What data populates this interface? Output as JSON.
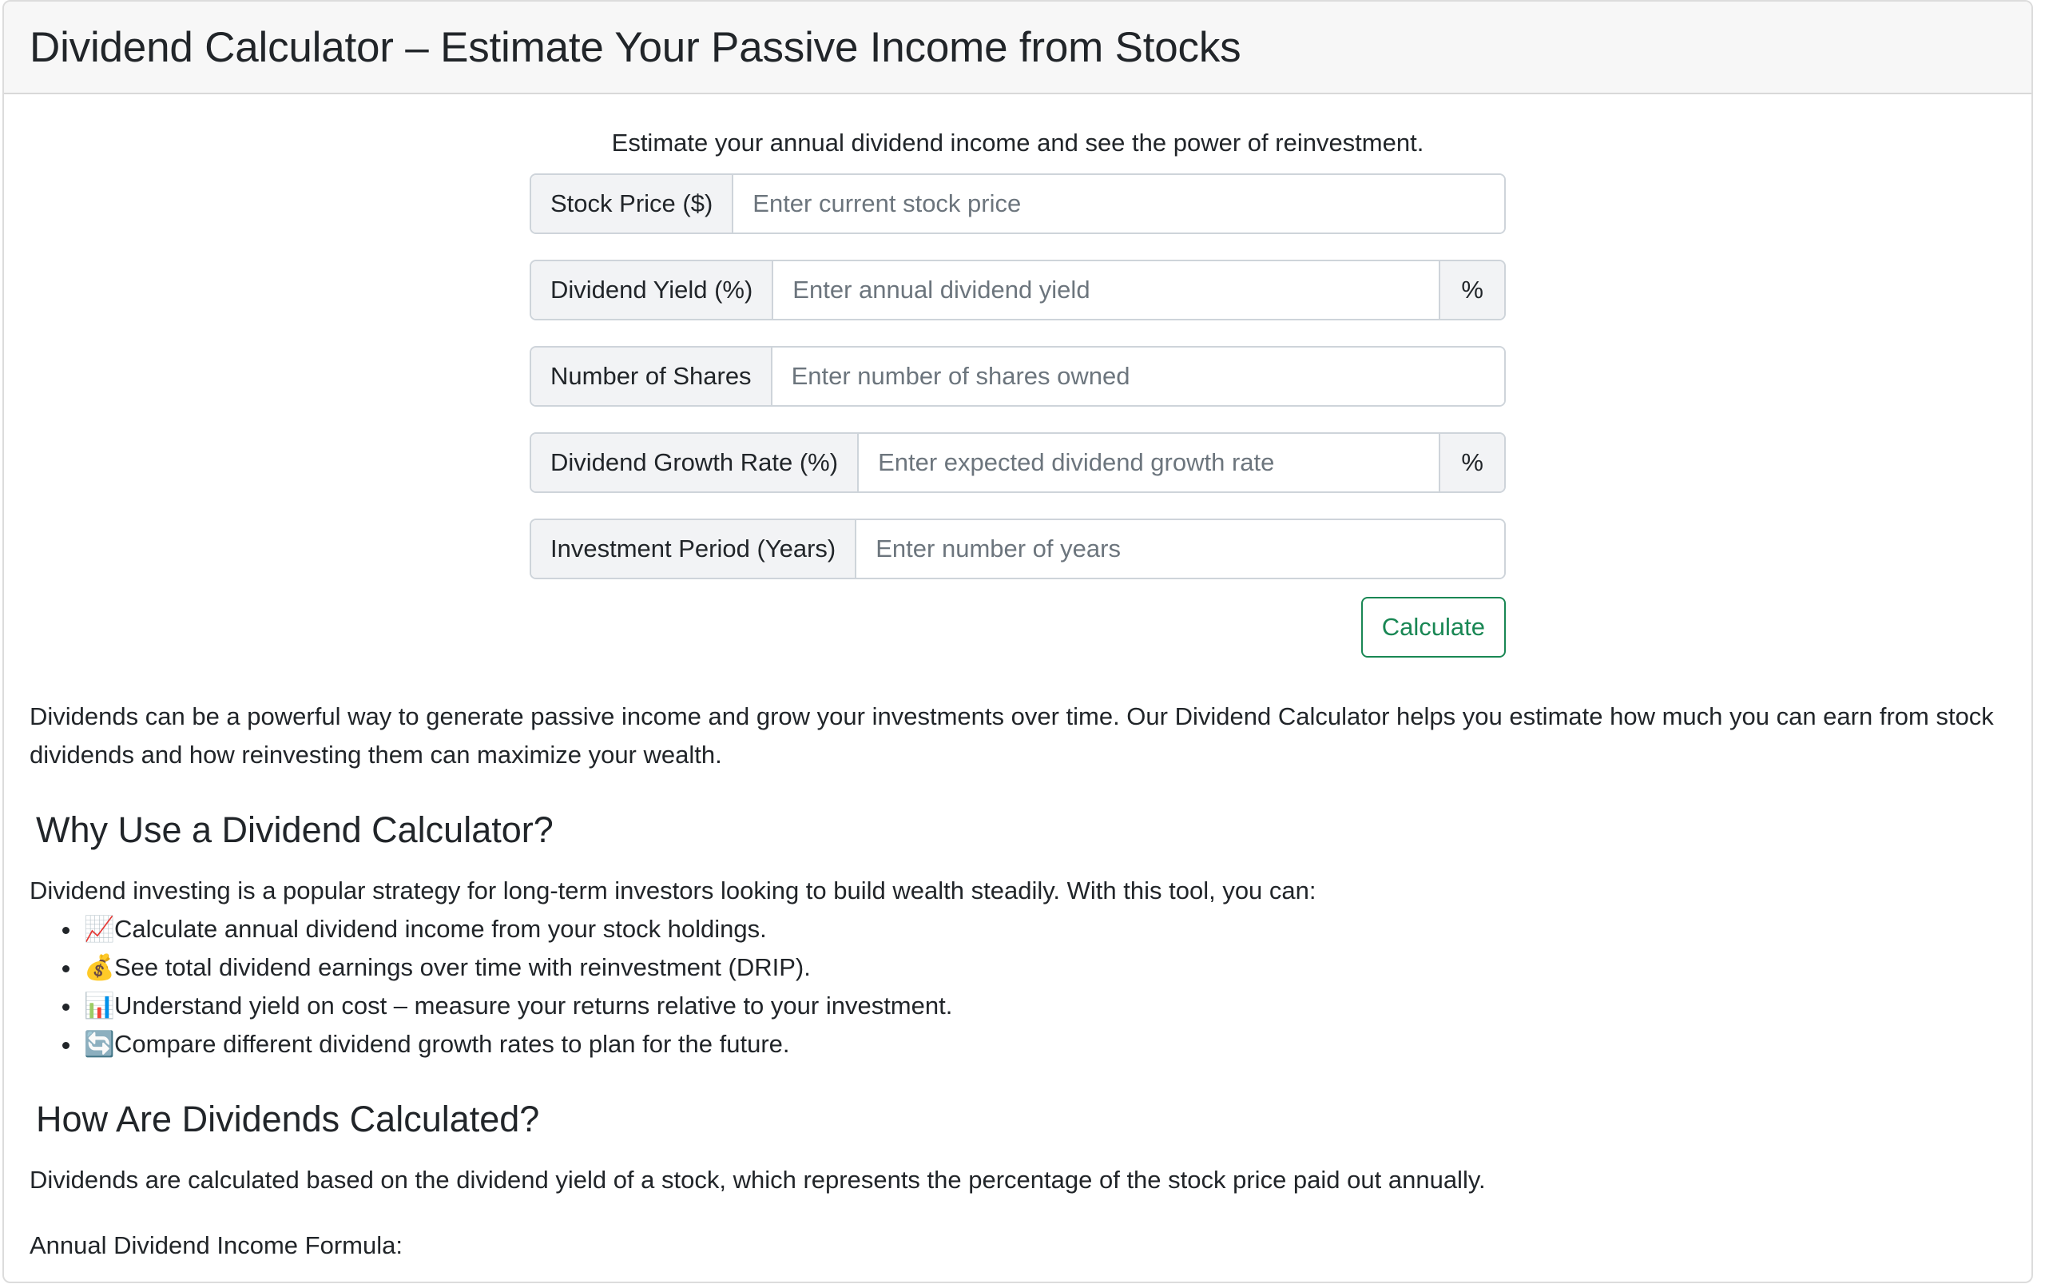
{
  "header": {
    "title": "Dividend Calculator – Estimate Your Passive Income from Stocks"
  },
  "intro": "Estimate your annual dividend income and see the power of reinvestment.",
  "form": {
    "stock_price": {
      "label": "Stock Price ($)",
      "placeholder": "Enter current stock price",
      "value": ""
    },
    "dividend_yield": {
      "label": "Dividend Yield (%)",
      "placeholder": "Enter annual dividend yield",
      "suffix": "%",
      "value": ""
    },
    "shares": {
      "label": "Number of Shares",
      "placeholder": "Enter number of shares owned",
      "value": ""
    },
    "growth_rate": {
      "label": "Dividend Growth Rate (%)",
      "placeholder": "Enter expected dividend growth rate",
      "suffix": "%",
      "value": ""
    },
    "period": {
      "label": "Investment Period (Years)",
      "placeholder": "Enter number of years",
      "value": ""
    },
    "calculate_label": "Calculate"
  },
  "content": {
    "description": "Dividends can be a powerful way to generate passive income and grow your investments over time. Our Dividend Calculator helps you estimate how much you can earn from stock dividends and how reinvesting them can maximize your wealth.",
    "why_heading": "Why Use a Dividend Calculator?",
    "why_intro": "Dividend investing is a popular strategy for long-term investors looking to build wealth steadily. With this tool, you can:",
    "features": [
      {
        "icon": "chart-increasing-icon",
        "glyph": "📈",
        "text": "Calculate annual dividend income from your stock holdings."
      },
      {
        "icon": "money-bag-icon",
        "glyph": "💰",
        "text": "See total dividend earnings over time with reinvestment (DRIP)."
      },
      {
        "icon": "bar-chart-icon",
        "glyph": "📊",
        "text": "Understand yield on cost – measure your returns relative to your investment."
      },
      {
        "icon": "repeat-arrows-icon",
        "glyph": "🔄",
        "text": "Compare different dividend growth rates to plan for the future."
      }
    ],
    "how_heading": "How Are Dividends Calculated?",
    "how_text": "Dividends are calculated based on the dividend yield of a stock, which represents the percentage of the stock price paid out annually.",
    "formula_label": "Annual Dividend Income Formula:"
  },
  "colors": {
    "accent_green": "#198754",
    "header_bg": "#f7f7f7",
    "addon_bg": "#f2f3f5",
    "border": "#ced4da"
  }
}
